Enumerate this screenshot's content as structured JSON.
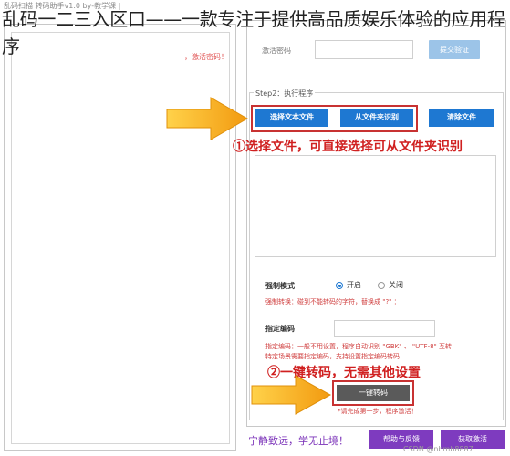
{
  "window": {
    "title": "乱码扫描 转码助手v1.0  by-教学课 |"
  },
  "overlay": {
    "title": "乱码一二三入区口——一款专注于提供高品质娱乐体验的应用程序"
  },
  "left_panel": {
    "red_text": "，激活密码！"
  },
  "activation": {
    "label": "激活密码",
    "input_value": "",
    "submit_label": "提交验证"
  },
  "step2": {
    "label": "Step2：执行程序",
    "select_file_label": "选择文本文件",
    "from_folder_label": "从文件夹识别",
    "clear_file_label": "清除文件"
  },
  "annotations": {
    "note1": "①选择文件，可直接选择可从文件夹识别",
    "note2": "②一键转码，无需其他设置"
  },
  "force_mode": {
    "label": "强制模式",
    "option_on": "开启",
    "option_off": "关闭",
    "selected": "开启",
    "hint": "强制转换：碰到不能转码的字符，替换成 \"?\" ："
  },
  "encoding": {
    "label": "指定编码",
    "input_value": "",
    "hint_line1": "指定编码：一般不用设置，程序自动识别 \"GBK\" 、 \"UTF-8\" 互转",
    "hint_line2": "特定场景需要指定编码，支持设置指定编码转码"
  },
  "convert": {
    "button_label": "一键转码",
    "hint": "*请完成第一步，程序激活！"
  },
  "footer": {
    "slogan": "宁静致远，学无止境！",
    "help_label": "帮助与反馈",
    "get_activation_label": "获取激活"
  },
  "watermark": {
    "text": "CSDN @nbmb8887"
  },
  "colors": {
    "primary_blue": "#1e78d2",
    "light_blue": "#9cc4e8",
    "purple": "#7e3bbf",
    "red_annotation": "#d02020",
    "arrow_orange": "#f2a51a"
  }
}
